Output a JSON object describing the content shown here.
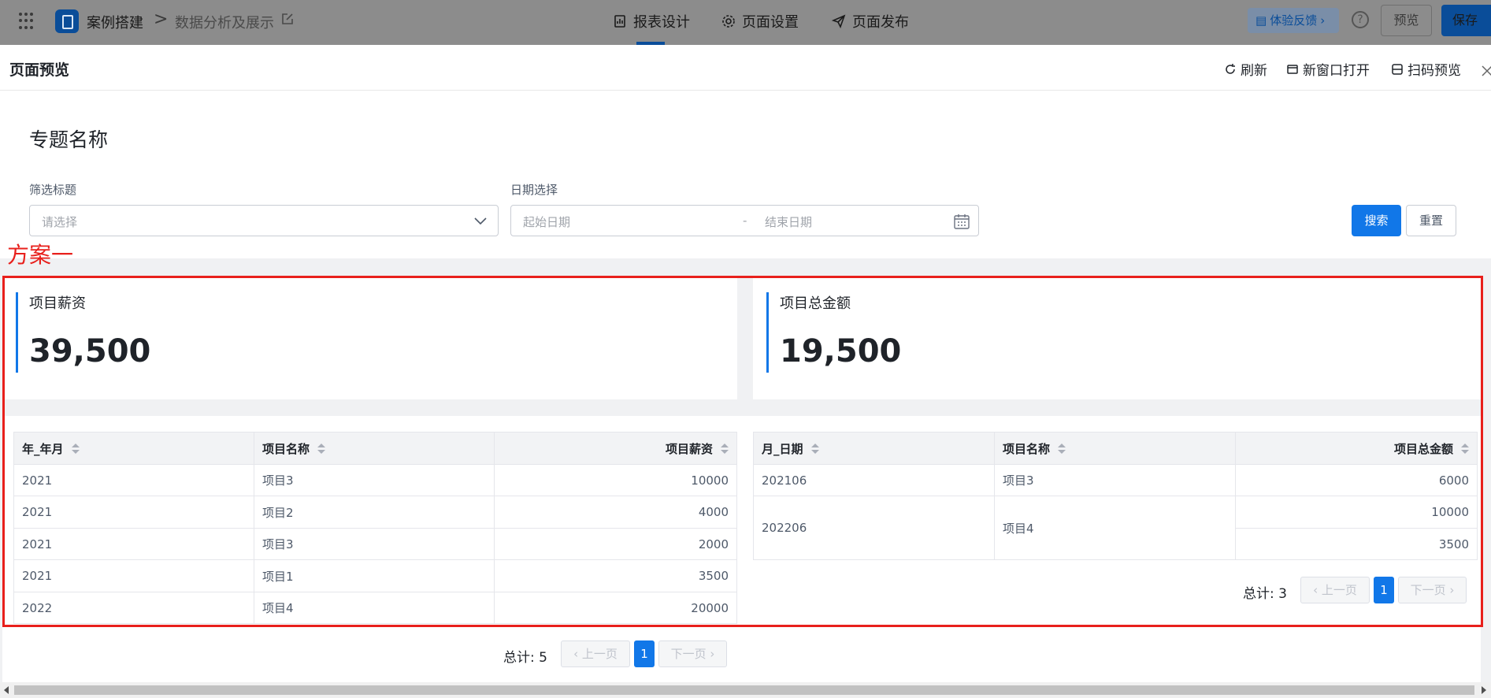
{
  "topbar": {
    "app_name": "案例搭建",
    "breadcrumb_sep": ">",
    "page_name": "数据分析及展示",
    "nav": [
      "报表设计",
      "页面设置",
      "页面发布"
    ],
    "feedback_label": "体验反馈",
    "help_label": "?",
    "preview_label": "预览",
    "save_label": "保存"
  },
  "panel": {
    "title": "页面预览",
    "actions": [
      "刷新",
      "新窗口打开",
      "扫码预览"
    ]
  },
  "topic_title": "专题名称",
  "filters": {
    "select_label": "筛选标题",
    "select_placeholder": "请选择",
    "date_label": "日期选择",
    "date_start_placeholder": "起始日期",
    "date_sep": "-",
    "date_end_placeholder": "结束日期",
    "search_label": "搜索",
    "reset_label": "重置"
  },
  "annotation": "方案一",
  "stats": [
    {
      "label": "项目薪资",
      "value": "39,500"
    },
    {
      "label": "项目总金额",
      "value": "19,500"
    }
  ],
  "table_left": {
    "columns": [
      "年_年月",
      "项目名称",
      "项目薪资"
    ],
    "rows": [
      [
        "2021",
        "项目3",
        "10000"
      ],
      [
        "2021",
        "项目2",
        "4000"
      ],
      [
        "2021",
        "项目3",
        "2000"
      ],
      [
        "2021",
        "项目1",
        "3500"
      ],
      [
        "2022",
        "项目4",
        "20000"
      ]
    ],
    "pagination": {
      "total": "总计: 5",
      "prev": "上一页",
      "page": "1",
      "next": "下一页"
    }
  },
  "table_right": {
    "columns": [
      "月_日期",
      "项目名称",
      "项目总金额"
    ],
    "rows": [
      {
        "date": "202106",
        "name": "项目3",
        "amounts": [
          "6000"
        ]
      },
      {
        "date": "202206",
        "name": "项目4",
        "amounts": [
          "10000",
          "3500"
        ]
      }
    ],
    "pagination": {
      "total": "总计: 3",
      "prev": "上一页",
      "page": "1",
      "next": "下一页"
    }
  },
  "colors": {
    "primary": "#1177e8",
    "annotation": "#e8201c",
    "topbar_dim": "#8c8c8c"
  }
}
